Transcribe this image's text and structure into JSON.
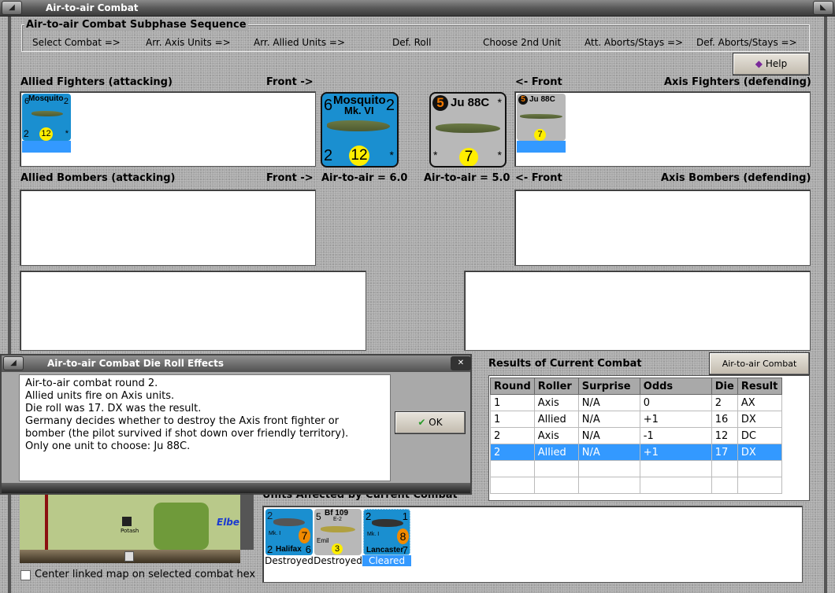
{
  "window": {
    "title": "Air-to-air Combat"
  },
  "subphase": {
    "title": "Air-to-air Combat Subphase Sequence",
    "steps": [
      "Select Combat =>",
      "Arr. Axis Units =>",
      "Arr. Allied Units =>",
      "Def. Roll",
      "Choose 2nd Unit",
      "Att. Aborts/Stays =>",
      "Def. Aborts/Stays =>"
    ]
  },
  "help_label": "Help",
  "sections": {
    "allied_fighters": "Allied Fighters (attacking)",
    "front_right": "Front ->",
    "front_left": "<- Front",
    "axis_fighters": "Axis Fighters (defending)",
    "allied_bombers": "Allied Bombers (attacking)",
    "axis_bombers": "Axis Bombers (defending)"
  },
  "allied_front": {
    "name": "Mosquito",
    "variant": "Mk. VI",
    "tl": "6",
    "tr": "2",
    "bl": "2",
    "br": "*",
    "strength": "12",
    "air_to_air": "Air-to-air = 6.0",
    "color": "#1a8fd0"
  },
  "axis_front": {
    "name": "Ju 88C",
    "tl": "5",
    "tr": "*",
    "bl": "*",
    "br": "*",
    "strength": "7",
    "air_to_air": "Air-to-air = 5.0",
    "color": "#b8b8b8"
  },
  "dialog": {
    "title": "Air-to-air Combat Die Roll Effects",
    "lines": [
      "Air-to-air combat round 2.",
      "Allied units fire on Axis units.",
      "Die roll was 17.  DX was the result.",
      "Germany decides whether to destroy the Axis front fighter or",
      "bomber (the pilot survived if shot down over friendly territory).",
      "Only one unit to choose: Ju 88C."
    ],
    "ok_label": "OK"
  },
  "results": {
    "title": "Results of Current Combat",
    "chart_button": "Air-to-air Combat Chart",
    "columns": [
      "Round",
      "Roller",
      "Surprise",
      "Odds",
      "Die",
      "Result"
    ],
    "rows": [
      [
        "1",
        "Axis",
        "N/A",
        "0",
        "2",
        "AX"
      ],
      [
        "1",
        "Allied",
        "N/A",
        "+1",
        "16",
        "DX"
      ],
      [
        "2",
        "Axis",
        "N/A",
        "-1",
        "12",
        "DC"
      ],
      [
        "2",
        "Allied",
        "N/A",
        "+1",
        "17",
        "DX"
      ]
    ],
    "selected_row": 3
  },
  "affected": {
    "title": "Units Affected by Current Combat",
    "units": [
      {
        "name": "Halifax",
        "variant": "Mk. I",
        "tl": "2",
        "bl": "2",
        "br": "6",
        "strength": "7",
        "status": "Destroyed"
      },
      {
        "name": "Bf 109",
        "variant": "E-2",
        "sub": "Emil",
        "tl": "5",
        "strength": "3",
        "status": "Destroyed"
      },
      {
        "name": "Lancaster",
        "variant": "Mk. I",
        "tl": "2",
        "tr": "1",
        "bl": "2",
        "br": "7",
        "strength": "8",
        "status": "Cleared"
      }
    ]
  },
  "map": {
    "river_label": "Elbe",
    "town_label": "Potash"
  },
  "center_map_label": "Center linked map on selected combat hex"
}
